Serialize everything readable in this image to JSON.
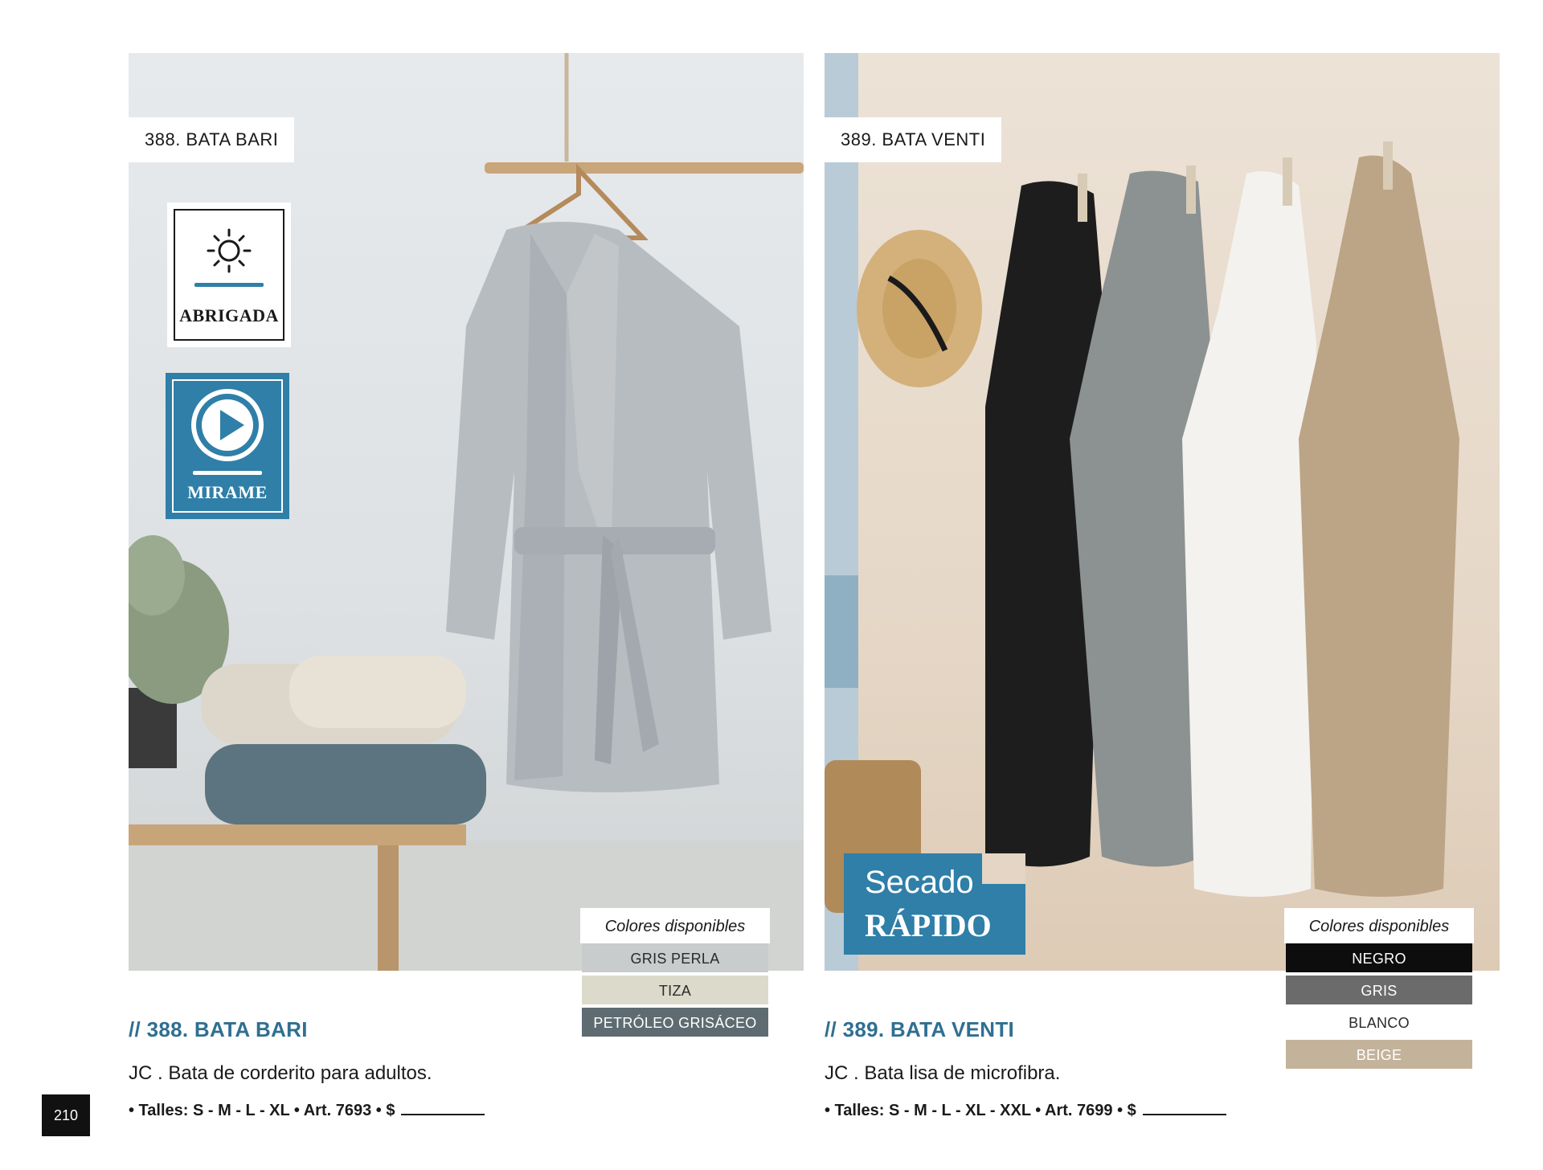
{
  "page": {
    "number": "210"
  },
  "products": [
    {
      "tag": "388. BATA BARI",
      "title": "// 388. BATA BARI",
      "description": "JC . Bata de corderito para adultos.",
      "details": "• Talles: S - M - L - XL • Art. 7693 • $",
      "badges": {
        "warm": "ABRIGADA",
        "video": "MIRAME"
      },
      "colors_heading": "Colores disponibles",
      "colors": [
        {
          "label": "GRIS PERLA",
          "bg": "#c9cccd",
          "fg": "#2a2a2a"
        },
        {
          "label": "TIZA",
          "bg": "#dcdacb",
          "fg": "#2a2a2a"
        },
        {
          "label": "PETRÓLEO GRISÁCEO",
          "bg": "#5e6c72",
          "fg": "#ffffff"
        }
      ]
    },
    {
      "tag": "389. BATA VENTI",
      "title": "// 389. BATA VENTI",
      "description": "JC . Bata lisa de microfibra.",
      "details": "• Talles: S - M - L - XL - XXL • Art. 7699 • $",
      "promo": {
        "line1": "Secado",
        "line2": "RÁPIDO"
      },
      "colors_heading": "Colores disponibles",
      "colors": [
        {
          "label": "NEGRO",
          "bg": "#0d0d0d",
          "fg": "#ffffff"
        },
        {
          "label": "GRIS",
          "bg": "#6b6b6b",
          "fg": "#ffffff"
        },
        {
          "label": "BLANCO",
          "bg": "#ffffff",
          "fg": "#2a2a2a"
        },
        {
          "label": "BEIGE",
          "bg": "#c4b39b",
          "fg": "#ffffff"
        }
      ]
    }
  ],
  "theme": {
    "accent": "#2f7fa8",
    "title_color": "#2f6f92"
  }
}
